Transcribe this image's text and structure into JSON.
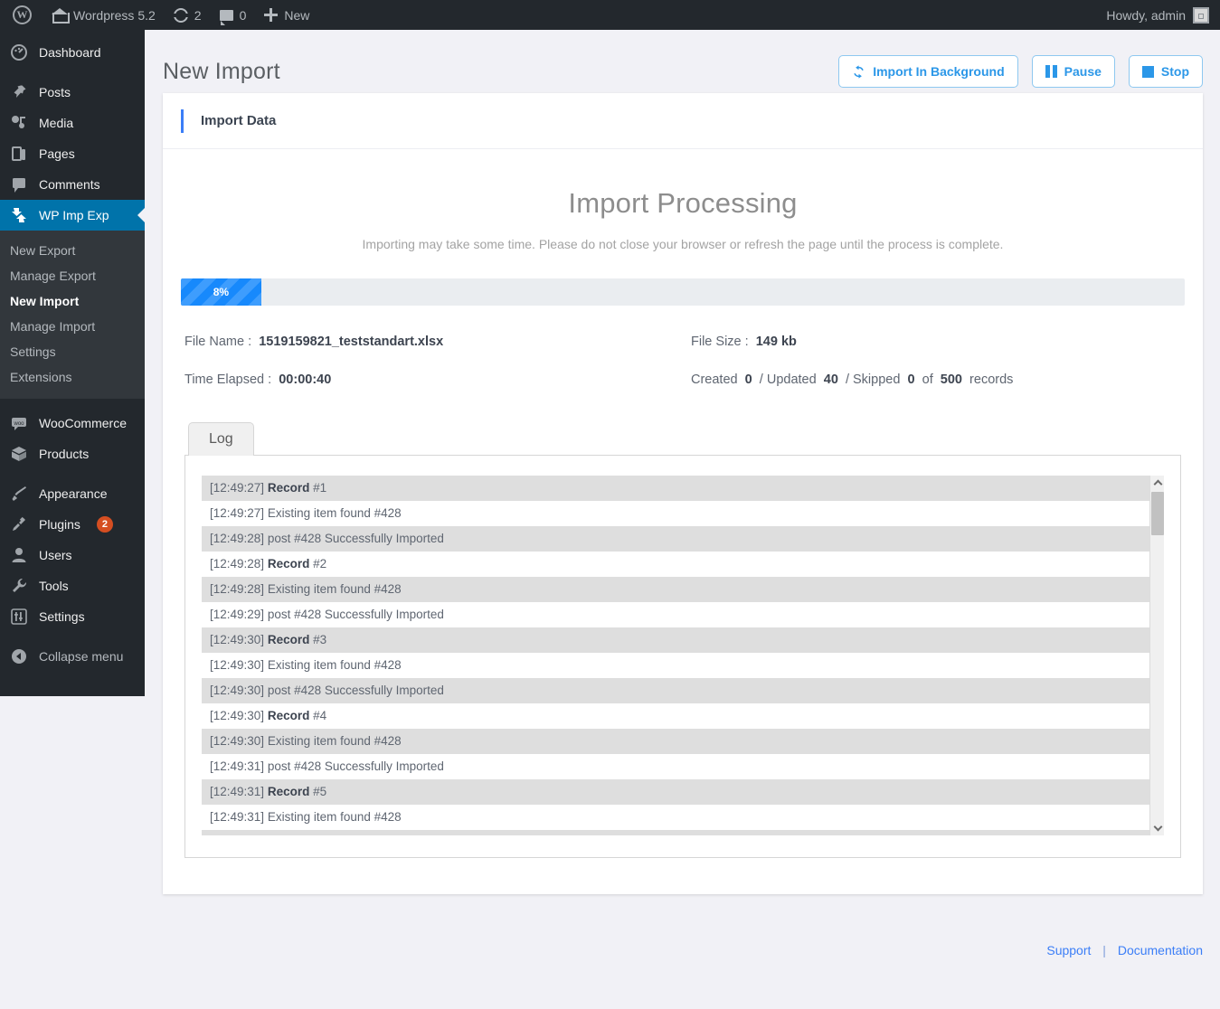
{
  "adminbar": {
    "site_name": "Wordpress 5.2",
    "updates_count": "2",
    "comments_count": "0",
    "new_label": "New",
    "howdy": "Howdy, admin"
  },
  "sidebar": {
    "items": [
      {
        "label": "Dashboard",
        "icon": "dashboard-icon"
      },
      {
        "label": "Posts",
        "icon": "posts-pin-icon"
      },
      {
        "label": "Media",
        "icon": "media-icon"
      },
      {
        "label": "Pages",
        "icon": "pages-icon"
      },
      {
        "label": "Comments",
        "icon": "comments-icon"
      },
      {
        "label": "WP Imp Exp",
        "icon": "import-export-icon"
      },
      {
        "label": "WooCommerce",
        "icon": "woocommerce-icon"
      },
      {
        "label": "Products",
        "icon": "products-box-icon"
      },
      {
        "label": "Appearance",
        "icon": "appearance-brush-icon"
      },
      {
        "label": "Plugins",
        "icon": "plugins-plug-icon",
        "badge": "2"
      },
      {
        "label": "Users",
        "icon": "users-icon"
      },
      {
        "label": "Tools",
        "icon": "tools-wrench-icon"
      },
      {
        "label": "Settings",
        "icon": "settings-sliders-icon"
      },
      {
        "label": "Collapse menu",
        "icon": "collapse-arrow-icon"
      }
    ],
    "submenu": [
      {
        "label": "New Export",
        "current": false
      },
      {
        "label": "Manage Export",
        "current": false
      },
      {
        "label": "New Import",
        "current": true
      },
      {
        "label": "Manage Import",
        "current": false
      },
      {
        "label": "Settings",
        "current": false
      },
      {
        "label": "Extensions",
        "current": false
      }
    ]
  },
  "header": {
    "page_title": "New Import",
    "buttons": {
      "import_background": "Import In Background",
      "pause": "Pause",
      "stop": "Stop"
    }
  },
  "card": {
    "header_title": "Import Data",
    "heading": "Import Processing",
    "subheading": "Importing may take some time. Please do not close your browser or refresh the page until the process is complete.",
    "progress": {
      "percent_label": "8%",
      "percent_value": 8,
      "bar_color": "#1789fc",
      "track_color": "#eaedf0"
    },
    "info": {
      "file_name_label": "File Name :",
      "file_name_value": "1519159821_teststandart.xlsx",
      "file_size_label": "File Size :",
      "file_size_value": "149 kb",
      "time_elapsed_label": "Time Elapsed :",
      "time_elapsed_value": "00:00:40",
      "created_label": "Created",
      "created_value": "0",
      "updated_label": "Updated",
      "updated_value": "40",
      "skipped_label": "Skipped",
      "skipped_value": "0",
      "of_label": "of",
      "total_value": "500",
      "records_label": "records",
      "slash": "/"
    },
    "tab_label": "Log",
    "log_rows": [
      {
        "time": "[12:49:27]",
        "bold": "Record",
        "rest": " #1"
      },
      {
        "time": "[12:49:27]",
        "bold": "",
        "rest": " Existing item found #428"
      },
      {
        "time": "[12:49:28]",
        "bold": "",
        "rest": " post #428 Successfully Imported"
      },
      {
        "time": "[12:49:28]",
        "bold": "Record",
        "rest": " #2"
      },
      {
        "time": "[12:49:28]",
        "bold": "",
        "rest": " Existing item found #428"
      },
      {
        "time": "[12:49:29]",
        "bold": "",
        "rest": " post #428 Successfully Imported"
      },
      {
        "time": "[12:49:30]",
        "bold": "Record",
        "rest": " #3"
      },
      {
        "time": "[12:49:30]",
        "bold": "",
        "rest": " Existing item found #428"
      },
      {
        "time": "[12:49:30]",
        "bold": "",
        "rest": " post #428 Successfully Imported"
      },
      {
        "time": "[12:49:30]",
        "bold": "Record",
        "rest": " #4"
      },
      {
        "time": "[12:49:30]",
        "bold": "",
        "rest": " Existing item found #428"
      },
      {
        "time": "[12:49:31]",
        "bold": "",
        "rest": " post #428 Successfully Imported"
      },
      {
        "time": "[12:49:31]",
        "bold": "Record",
        "rest": " #5"
      },
      {
        "time": "[12:49:31]",
        "bold": "",
        "rest": " Existing item found #428"
      },
      {
        "time": "",
        "bold": "",
        "rest": ""
      }
    ]
  },
  "footer": {
    "support": "Support",
    "separator": "|",
    "documentation": "Documentation"
  }
}
